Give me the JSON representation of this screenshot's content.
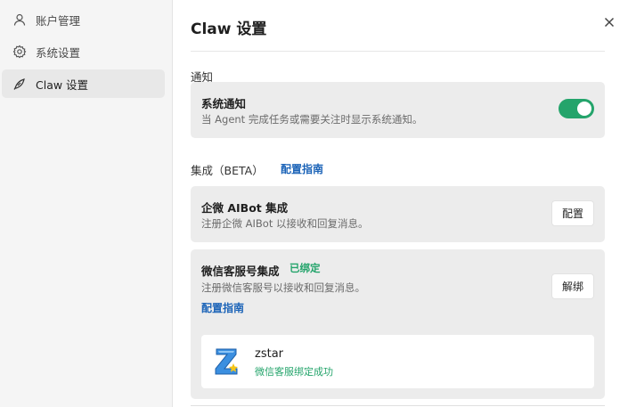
{
  "sidebar": {
    "items": [
      {
        "label": "账户管理",
        "icon": "user-icon",
        "active": false
      },
      {
        "label": "系统设置",
        "icon": "gear-icon",
        "active": false
      },
      {
        "label": "Claw 设置",
        "icon": "claw-icon",
        "active": true
      }
    ]
  },
  "header": {
    "title": "Claw 设置",
    "close_icon": "close-icon"
  },
  "notifications": {
    "section_label": "通知",
    "system_title": "系统通知",
    "system_desc": "当 Agent 完成任务或需要关注时显示系统通知。",
    "toggle_on": true
  },
  "integrations": {
    "section_label": "集成（BETA）",
    "guide_link": "配置指南",
    "wecom": {
      "title": "企微 AIBot 集成",
      "desc": "注册企微 AIBot 以接收和回复消息。",
      "button": "配置"
    },
    "wechat_cs": {
      "title": "微信客服号集成",
      "status": "已绑定",
      "desc": "注册微信客服号以接收和回复消息。",
      "guide_link": "配置指南",
      "button": "解绑",
      "account": {
        "name": "zstar",
        "status": "微信客服绑定成功"
      }
    }
  },
  "colors": {
    "accent_green": "#24a46b",
    "link_blue": "#1c64b8",
    "sidebar_bg": "#f5f5f5",
    "card_bg": "#ececec"
  }
}
